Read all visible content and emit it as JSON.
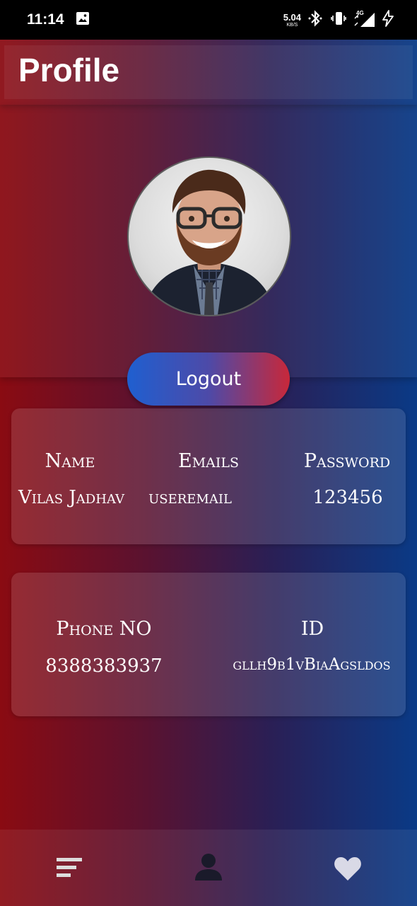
{
  "status_bar": {
    "time": "11:14",
    "net_speed": "5.04",
    "net_unit": "KB/S",
    "network_label": "4G",
    "icons": [
      "image-icon",
      "bluetooth-icon",
      "vibrate-icon",
      "signal-icon",
      "charging-icon"
    ]
  },
  "header": {
    "title": "Profile"
  },
  "profile": {
    "avatar": "profile-photo"
  },
  "actions": {
    "logout_label": "Logout"
  },
  "card1": {
    "name_label": "Name",
    "emails_label": "Emails",
    "password_label": "Password",
    "name_value": "Vilas Jadhav",
    "email_value": "useremail",
    "password_value": "123456"
  },
  "card2": {
    "phone_label": "Phone NO",
    "id_label": "ID",
    "phone_value": "8388383937",
    "id_value": "gllh9b1vBiaAgsldos"
  },
  "bottom_nav": {
    "items": [
      {
        "icon": "menu-icon"
      },
      {
        "icon": "person-icon"
      },
      {
        "icon": "heart-icon"
      }
    ]
  },
  "colors": {
    "gradient_left": "#8a0b12",
    "gradient_right": "#0a3a86",
    "logout_left": "#1f5fd0",
    "logout_right": "#c8283a"
  }
}
